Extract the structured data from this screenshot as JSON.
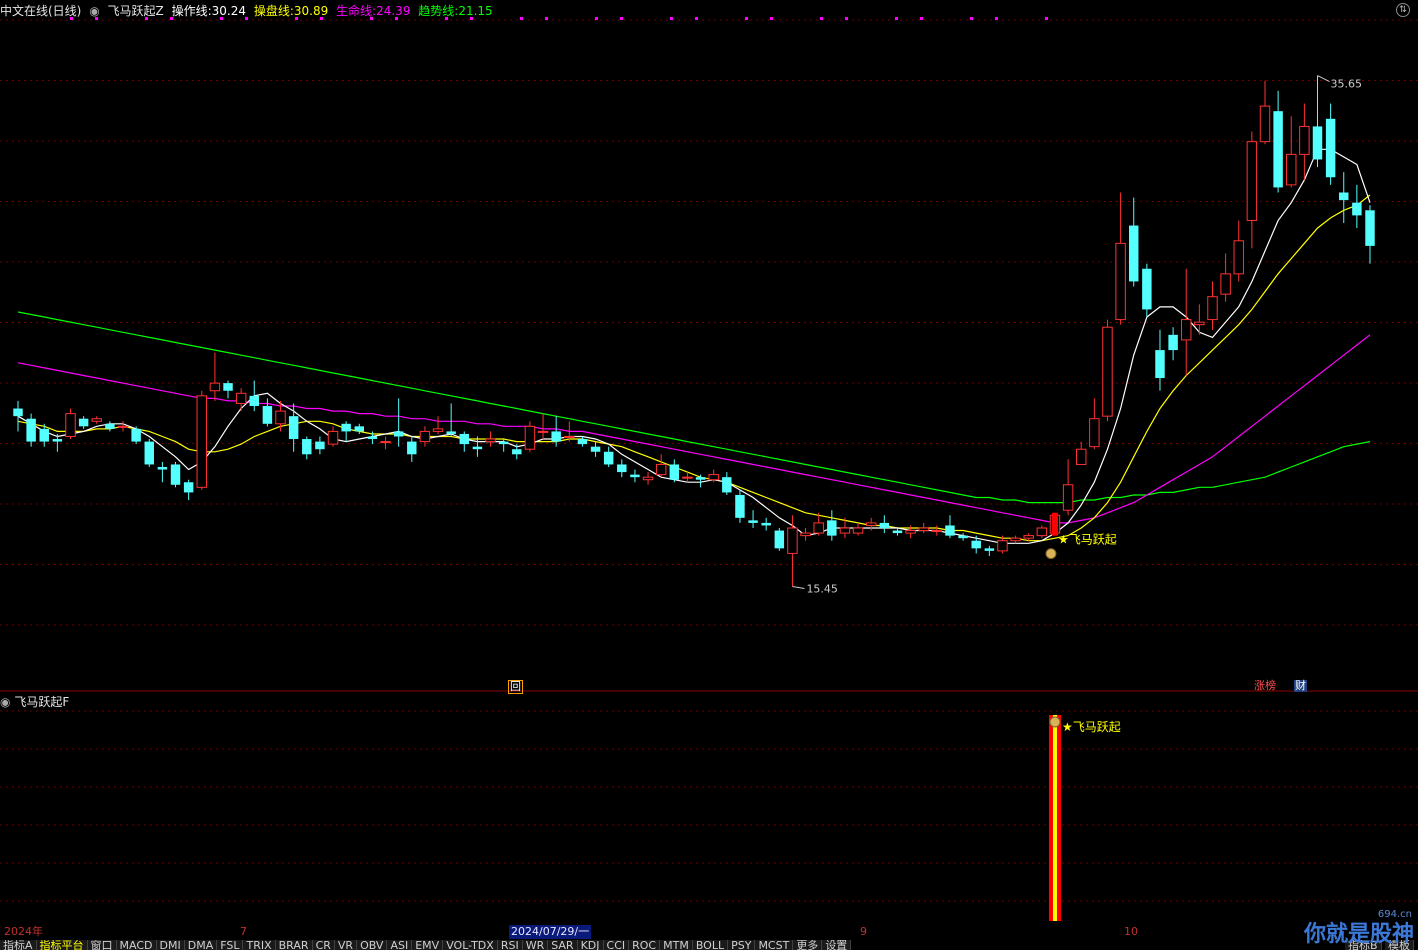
{
  "header": {
    "title": "中文在线(日线)",
    "indicator_name": "飞马跃起Z",
    "values": [
      {
        "label": "操作线:",
        "value": "30.24",
        "color": "#ffffff"
      },
      {
        "label": "操盘线:",
        "value": "30.89",
        "color": "#ffff00"
      },
      {
        "label": "生命线:",
        "value": "24.39",
        "color": "#ff00ff"
      },
      {
        "label": "趋势线:",
        "value": "21.15",
        "color": "#00ff00"
      }
    ]
  },
  "main_chart": {
    "high_label": "35.65",
    "low_label": "15.45",
    "signal_text": "飞马跃起",
    "badges": {
      "hui": "回",
      "zhangting": "涨榜",
      "cai": "财"
    }
  },
  "sub_chart": {
    "title": "飞马跃起F",
    "signal_text": "飞马跃起"
  },
  "date_axis": {
    "labels": [
      "2024年",
      "7",
      "2024/07/29/一",
      "9",
      "10"
    ]
  },
  "tabs": {
    "items": [
      "指标A",
      "指标平台",
      "窗口",
      "MACD",
      "DMI",
      "DMA",
      "FSL",
      "TRIX",
      "BRAR",
      "CR",
      "VR",
      "OBV",
      "ASI",
      "EMV",
      "VOL-TDX",
      "RSI",
      "WR",
      "SAR",
      "KDJ",
      "CCI",
      "ROC",
      "MTM",
      "BOLL",
      "PSY",
      "MCST",
      "更多",
      "设置"
    ],
    "right": [
      "指标B",
      "模板"
    ]
  },
  "watermark": {
    "text": "你就是股神",
    "site": "694.cn"
  },
  "colors": {
    "up": "#ff3232",
    "down": "#54ffff",
    "ma_fast": "#ffffff",
    "ma_mid": "#ffff00",
    "ma_life": "#ff00ff",
    "ma_trend": "#00ff00",
    "grid": "#6e0000"
  },
  "chart_data": {
    "type": "candlestick",
    "y_range": [
      13,
      37
    ],
    "candles": [
      [
        22.5,
        22.2,
        22.8,
        21.6
      ],
      [
        22.1,
        21.2,
        22.3,
        21.0
      ],
      [
        21.7,
        21.2,
        21.9,
        21.0
      ],
      [
        21.3,
        21.2,
        21.5,
        20.8
      ],
      [
        21.4,
        22.3,
        22.5,
        21.3
      ],
      [
        22.1,
        21.8,
        22.2,
        21.7
      ],
      [
        22.0,
        22.1,
        22.2,
        21.9
      ],
      [
        21.9,
        21.7,
        22.0,
        21.6
      ],
      [
        21.8,
        21.8,
        22.0,
        21.6
      ],
      [
        21.7,
        21.2,
        21.8,
        21.1
      ],
      [
        21.2,
        20.3,
        21.3,
        20.2
      ],
      [
        20.2,
        20.1,
        20.4,
        19.6
      ],
      [
        20.3,
        19.5,
        20.4,
        19.4
      ],
      [
        19.6,
        19.2,
        19.7,
        18.9
      ],
      [
        19.4,
        23.0,
        23.2,
        19.3
      ],
      [
        23.2,
        23.5,
        24.7,
        22.8
      ],
      [
        23.5,
        23.2,
        23.6,
        22.9
      ],
      [
        22.7,
        23.1,
        23.3,
        22.4
      ],
      [
        23.0,
        22.6,
        23.6,
        22.4
      ],
      [
        22.6,
        21.9,
        22.9,
        21.8
      ],
      [
        21.9,
        22.4,
        22.8,
        21.6
      ],
      [
        22.2,
        21.3,
        22.7,
        20.8
      ],
      [
        21.3,
        20.7,
        21.4,
        20.5
      ],
      [
        21.2,
        20.9,
        21.4,
        20.7
      ],
      [
        21.1,
        21.6,
        21.8,
        21.0
      ],
      [
        21.9,
        21.6,
        22.0,
        21.2
      ],
      [
        21.8,
        21.6,
        21.9,
        21.5
      ],
      [
        21.4,
        21.3,
        21.6,
        21.1
      ],
      [
        21.2,
        21.2,
        21.4,
        20.9
      ],
      [
        21.6,
        21.4,
        22.9,
        21.0
      ],
      [
        21.2,
        20.7,
        21.4,
        20.4
      ],
      [
        21.2,
        21.6,
        21.8,
        21.0
      ],
      [
        21.6,
        21.7,
        22.2,
        21.5
      ],
      [
        21.6,
        21.5,
        22.7,
        21.4
      ],
      [
        21.5,
        21.1,
        21.6,
        20.8
      ],
      [
        21.0,
        20.9,
        21.4,
        20.6
      ],
      [
        21.2,
        21.3,
        21.6,
        21.0
      ],
      [
        21.2,
        21.1,
        21.3,
        20.8
      ],
      [
        20.9,
        20.7,
        21.1,
        20.5
      ],
      [
        20.9,
        21.8,
        22.0,
        20.8
      ],
      [
        21.6,
        21.6,
        22.3,
        21.3
      ],
      [
        21.6,
        21.2,
        22.2,
        21.0
      ],
      [
        21.4,
        21.4,
        22.0,
        21.2
      ],
      [
        21.3,
        21.1,
        21.4,
        21.0
      ],
      [
        21.0,
        20.8,
        21.2,
        20.6
      ],
      [
        20.8,
        20.3,
        21.0,
        20.2
      ],
      [
        20.3,
        20.0,
        20.5,
        19.8
      ],
      [
        19.9,
        19.8,
        20.1,
        19.6
      ],
      [
        19.7,
        19.8,
        20.0,
        19.5
      ],
      [
        19.9,
        20.3,
        20.7,
        19.8
      ],
      [
        20.3,
        19.7,
        20.5,
        19.6
      ],
      [
        19.8,
        19.8,
        20.0,
        19.6
      ],
      [
        19.8,
        19.7,
        19.9,
        19.4
      ],
      [
        19.7,
        19.9,
        20.1,
        19.6
      ],
      [
        19.8,
        19.2,
        20.0,
        19.1
      ],
      [
        19.1,
        18.2,
        19.3,
        18.0
      ],
      [
        18.1,
        18.0,
        18.5,
        17.8
      ],
      [
        18.0,
        17.9,
        18.2,
        17.7
      ],
      [
        17.7,
        17.0,
        17.8,
        16.9
      ],
      [
        16.8,
        17.8,
        18.3,
        15.5
      ],
      [
        17.5,
        17.6,
        17.8,
        17.3
      ],
      [
        17.6,
        18.0,
        18.4,
        17.5
      ],
      [
        18.1,
        17.5,
        18.5,
        17.3
      ],
      [
        17.6,
        17.8,
        18.2,
        17.4
      ],
      [
        17.6,
        17.8,
        18.0,
        17.5
      ],
      [
        17.9,
        18.0,
        18.2,
        17.7
      ],
      [
        18.0,
        17.8,
        18.3,
        17.6
      ],
      [
        17.7,
        17.6,
        17.8,
        17.5
      ],
      [
        17.6,
        17.7,
        17.9,
        17.4
      ],
      [
        17.7,
        17.8,
        18.0,
        17.6
      ],
      [
        17.7,
        17.7,
        17.9,
        17.5
      ],
      [
        17.9,
        17.5,
        18.3,
        17.4
      ],
      [
        17.5,
        17.4,
        17.6,
        17.3
      ],
      [
        17.3,
        17.0,
        17.5,
        16.8
      ],
      [
        17.0,
        16.9,
        17.1,
        16.7
      ],
      [
        16.9,
        17.3,
        17.5,
        16.8
      ],
      [
        17.3,
        17.4,
        17.5,
        17.2
      ],
      [
        17.4,
        17.5,
        17.6,
        17.3
      ],
      [
        17.5,
        17.8,
        17.9,
        17.4
      ],
      [
        17.6,
        18.3,
        18.4,
        17.5
      ],
      [
        18.5,
        19.5,
        20.5,
        18.3
      ],
      [
        20.3,
        20.9,
        21.2,
        20.3
      ],
      [
        21.0,
        22.1,
        22.9,
        20.9
      ],
      [
        22.2,
        25.7,
        26.0,
        22.0
      ],
      [
        26.0,
        29.0,
        31.0,
        25.8
      ],
      [
        29.7,
        27.5,
        30.8,
        27.3
      ],
      [
        28.0,
        26.4,
        28.2,
        26.1
      ],
      [
        24.8,
        23.7,
        25.6,
        23.2
      ],
      [
        25.4,
        24.8,
        25.7,
        24.4
      ],
      [
        25.2,
        26.0,
        28.0,
        23.8
      ],
      [
        25.8,
        25.9,
        26.6,
        25.4
      ],
      [
        26.0,
        26.9,
        27.5,
        25.6
      ],
      [
        27.0,
        27.8,
        28.6,
        26.7
      ],
      [
        27.8,
        29.1,
        29.9,
        27.5
      ],
      [
        29.9,
        33.0,
        33.4,
        28.8
      ],
      [
        33.0,
        34.4,
        35.4,
        32.9
      ],
      [
        34.2,
        31.2,
        35.0,
        31.0
      ],
      [
        31.3,
        32.5,
        34.0,
        31.2
      ],
      [
        32.5,
        33.6,
        34.5,
        31.5
      ],
      [
        33.6,
        32.3,
        35.6,
        32.0
      ],
      [
        33.9,
        31.6,
        34.5,
        31.3
      ],
      [
        31.0,
        30.7,
        31.8,
        29.8
      ],
      [
        30.6,
        30.1,
        31.3,
        29.6
      ],
      [
        30.3,
        28.9,
        30.5,
        28.2
      ]
    ],
    "ma_white": [
      22.2,
      21.9,
      21.6,
      21.4,
      21.5,
      21.6,
      21.8,
      21.9,
      21.9,
      21.7,
      21.4,
      21.0,
      20.6,
      20.1,
      20.4,
      21.0,
      21.8,
      22.5,
      23.0,
      23.1,
      22.7,
      22.4,
      22.0,
      21.7,
      21.3,
      21.2,
      21.3,
      21.4,
      21.5,
      21.6,
      21.4,
      21.3,
      21.4,
      21.5,
      21.3,
      21.2,
      21.2,
      21.2,
      21.0,
      21.1,
      21.3,
      21.3,
      21.4,
      21.4,
      21.3,
      21.1,
      20.7,
      20.4,
      20.1,
      19.8,
      19.7,
      19.6,
      19.6,
      19.7,
      19.6,
      19.3,
      19.0,
      18.6,
      18.2,
      17.9,
      17.5,
      17.6,
      17.8,
      17.8,
      17.8,
      17.8,
      17.8,
      17.8,
      17.7,
      17.7,
      17.7,
      17.6,
      17.5,
      17.4,
      17.3,
      17.2,
      17.2,
      17.2,
      17.3,
      17.6,
      18.0,
      18.7,
      19.6,
      20.9,
      22.5,
      24.6,
      26.1,
      26.5,
      26.5,
      26.1,
      25.5,
      25.3,
      25.9,
      26.5,
      27.5,
      28.7,
      29.9,
      30.6,
      31.5,
      32.7,
      32.7,
      32.4,
      32.1,
      30.6
    ],
    "ma_yellow": [
      22.0,
      21.9,
      21.8,
      21.6,
      21.6,
      21.6,
      21.7,
      21.7,
      21.8,
      21.7,
      21.6,
      21.4,
      21.2,
      20.9,
      20.8,
      20.8,
      20.9,
      21.1,
      21.4,
      21.6,
      21.8,
      21.9,
      22.0,
      22.0,
      21.9,
      21.7,
      21.6,
      21.5,
      21.5,
      21.5,
      21.4,
      21.4,
      21.4,
      21.4,
      21.3,
      21.3,
      21.3,
      21.3,
      21.2,
      21.2,
      21.2,
      21.2,
      21.3,
      21.3,
      21.2,
      21.1,
      21.0,
      20.8,
      20.6,
      20.4,
      20.2,
      20.0,
      19.8,
      19.7,
      19.6,
      19.4,
      19.2,
      19.0,
      18.8,
      18.6,
      18.4,
      18.3,
      18.2,
      18.1,
      18.0,
      17.9,
      17.9,
      17.8,
      17.8,
      17.8,
      17.8,
      17.7,
      17.7,
      17.6,
      17.5,
      17.4,
      17.4,
      17.3,
      17.3,
      17.4,
      17.5,
      17.8,
      18.2,
      18.8,
      19.6,
      20.6,
      21.6,
      22.5,
      23.2,
      23.8,
      24.3,
      24.8,
      25.3,
      25.8,
      26.4,
      27.1,
      27.8,
      28.4,
      29.0,
      29.6,
      30.0,
      30.3,
      30.5,
      30.9
    ],
    "ma_life": [
      24.3,
      24.2,
      24.1,
      24.0,
      23.9,
      23.8,
      23.7,
      23.6,
      23.5,
      23.4,
      23.3,
      23.2,
      23.1,
      23.0,
      22.9,
      22.9,
      22.8,
      22.8,
      22.7,
      22.7,
      22.6,
      22.6,
      22.5,
      22.5,
      22.4,
      22.4,
      22.3,
      22.3,
      22.2,
      22.2,
      22.1,
      22.1,
      22.0,
      22.0,
      22.0,
      21.9,
      21.9,
      21.8,
      21.8,
      21.8,
      21.7,
      21.7,
      21.6,
      21.6,
      21.5,
      21.4,
      21.3,
      21.2,
      21.1,
      21.0,
      20.9,
      20.8,
      20.7,
      20.6,
      20.5,
      20.4,
      20.3,
      20.2,
      20.1,
      20.0,
      19.9,
      19.8,
      19.7,
      19.6,
      19.5,
      19.4,
      19.3,
      19.2,
      19.1,
      19.0,
      18.9,
      18.8,
      18.7,
      18.6,
      18.5,
      18.4,
      18.3,
      18.2,
      18.1,
      18.0,
      18.0,
      18.1,
      18.2,
      18.4,
      18.6,
      18.8,
      19.1,
      19.4,
      19.7,
      20.0,
      20.3,
      20.6,
      21.0,
      21.4,
      21.8,
      22.2,
      22.6,
      23.0,
      23.4,
      23.8,
      24.2,
      24.6,
      25.0,
      25.4
    ],
    "ma_trend": [
      26.3,
      26.2,
      26.1,
      26.0,
      25.9,
      25.8,
      25.7,
      25.6,
      25.5,
      25.4,
      25.3,
      25.2,
      25.1,
      25.0,
      24.9,
      24.8,
      24.7,
      24.6,
      24.5,
      24.4,
      24.3,
      24.2,
      24.1,
      24.0,
      23.9,
      23.8,
      23.7,
      23.6,
      23.5,
      23.4,
      23.3,
      23.2,
      23.1,
      23.0,
      22.9,
      22.8,
      22.7,
      22.6,
      22.5,
      22.4,
      22.3,
      22.2,
      22.1,
      22.0,
      21.9,
      21.8,
      21.7,
      21.6,
      21.5,
      21.4,
      21.3,
      21.2,
      21.1,
      21.0,
      20.9,
      20.8,
      20.7,
      20.6,
      20.5,
      20.4,
      20.3,
      20.2,
      20.1,
      20.0,
      19.9,
      19.8,
      19.7,
      19.6,
      19.5,
      19.4,
      19.3,
      19.2,
      19.1,
      19.0,
      19.0,
      18.9,
      18.9,
      18.8,
      18.8,
      18.8,
      18.8,
      18.9,
      18.9,
      19.0,
      19.0,
      19.1,
      19.1,
      19.2,
      19.2,
      19.3,
      19.4,
      19.4,
      19.5,
      19.6,
      19.7,
      19.8,
      20.0,
      20.2,
      20.4,
      20.6,
      20.8,
      21.0,
      21.1,
      21.2
    ],
    "signal_index": 79
  }
}
